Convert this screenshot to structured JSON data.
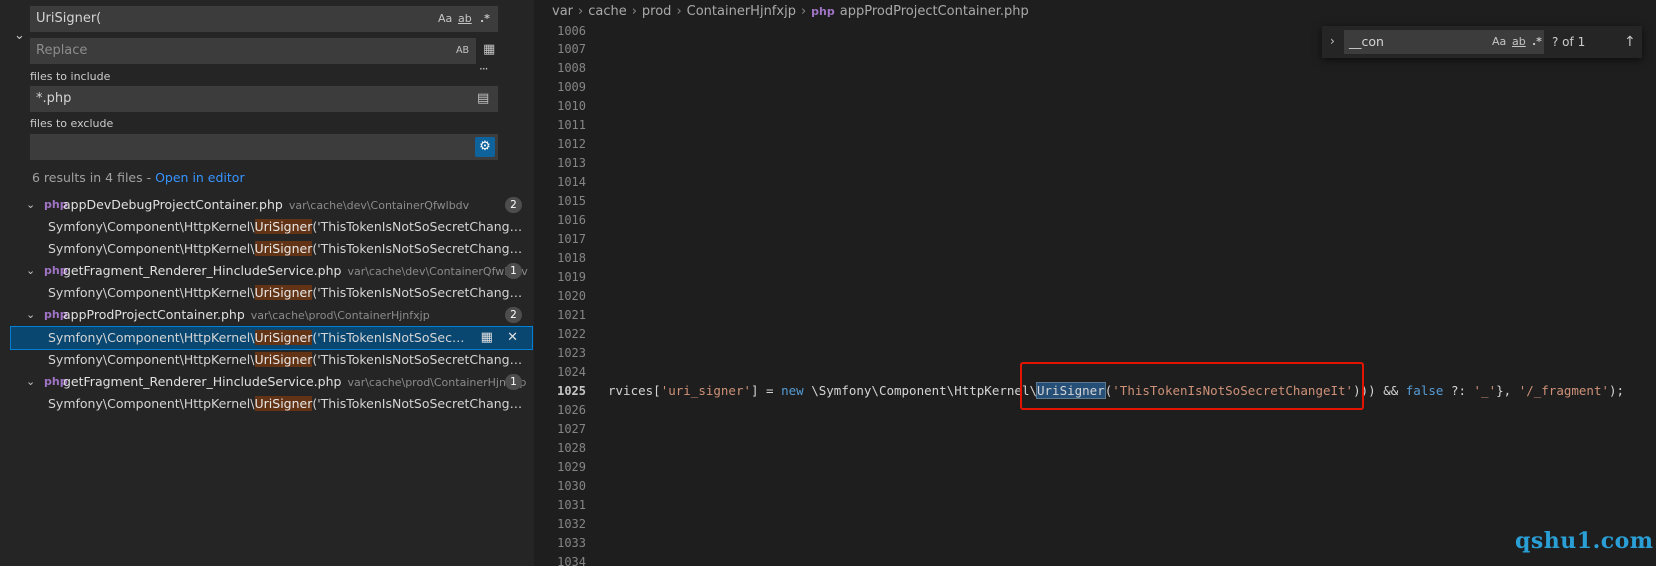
{
  "search": {
    "query": "UriSigner(",
    "replace_placeholder": "Replace",
    "opt_case": "Aa",
    "opt_word": "ab",
    "opt_regex": ".*",
    "opt_preserve_case": "AB",
    "files_to_include_label": "files to include",
    "files_to_include_value": "*.php",
    "files_to_exclude_label": "files to exclude",
    "files_to_exclude_value": "",
    "summary_text": "6 results in 4 files - ",
    "open_in_editor": "Open in editor",
    "more": "···"
  },
  "results": [
    {
      "type": "file",
      "icon": "php-icon",
      "name": "appDevDebugProjectContainer.php",
      "path": "var\\cache\\dev\\ContainerQfwlbdv",
      "count": "2"
    },
    {
      "type": "match",
      "pre": "Symfony\\Component\\HttpKernel\\",
      "hl": "UriSigner",
      "post": "('ThisTokenIsNotSoSecretChangeIt'))) &..."
    },
    {
      "type": "match",
      "pre": "Symfony\\Component\\HttpKernel\\",
      "hl": "UriSigner",
      "post": "('ThisTokenIsNotSoSecretChangeIt');"
    },
    {
      "type": "file",
      "icon": "php-icon",
      "name": "getFragment_Renderer_HincludeService.php",
      "path": "var\\cache\\dev\\ContainerQfwlbdv",
      "count": "1"
    },
    {
      "type": "match",
      "pre": "Symfony\\Component\\HttpKernel\\",
      "hl": "UriSigner",
      "post": "('ThisTokenIsNotSoSecretChangeIt'))) &..."
    },
    {
      "type": "file",
      "icon": "php-icon",
      "name": "appProdProjectContainer.php",
      "path": "var\\cache\\prod\\ContainerHjnfxjp",
      "count": "2"
    },
    {
      "type": "match",
      "selected": true,
      "pre": "Symfony\\Component\\HttpKernel\\",
      "hl": "UriSigner",
      "post": "('ThisTokenIsNotSoSecretCha..."
    },
    {
      "type": "match",
      "pre": "Symfony\\Component\\HttpKernel\\",
      "hl": "UriSigner",
      "post": "('ThisTokenIsNotSoSecretChangeIt');"
    },
    {
      "type": "file",
      "icon": "php-icon",
      "name": "getFragment_Renderer_HincludeService.php",
      "path": "var\\cache\\prod\\ContainerHjnfxjp",
      "count": "1"
    },
    {
      "type": "match",
      "pre": "Symfony\\Component\\HttpKernel\\",
      "hl": "UriSigner",
      "post": "('ThisTokenIsNotSoSecretChangeIt'))) &..."
    }
  ],
  "breadcrumb": [
    "var",
    "cache",
    "prod",
    "ContainerHjnfxjp",
    "appProdProjectContainer.php"
  ],
  "line_numbers": [
    "1006",
    "1007",
    "1008",
    "1009",
    "1010",
    "1011",
    "1012",
    "1013",
    "1014",
    "1015",
    "1016",
    "1017",
    "1018",
    "1019",
    "1020",
    "1021",
    "1022",
    "1023",
    "1024",
    "1025",
    "1026",
    "1027",
    "1028",
    "1029",
    "1030",
    "1031",
    "1032",
    "1033",
    "1034"
  ],
  "active_line": "1025",
  "code_line": {
    "p1": "rvices[",
    "s1": "'uri_signer'",
    "p2": "] = ",
    "k1": "new",
    "p3": " \\Symfony\\Component\\HttpKerne",
    "p4": "l\\",
    "cls": "UriSigner",
    "p5": "(",
    "s2": "'ThisTokenIsNotSoSecretChangeIt'",
    "p6": "))) && ",
    "k2": "false",
    "p7": " ?: ",
    "s3": "'_'",
    "p8": "}, ",
    "s4": "'/_fragment'",
    "p9": ");"
  },
  "find_widget": {
    "value": "__con",
    "opt_case": "Aa",
    "opt_word": "ab",
    "opt_regex": ".*",
    "count": "? of 1"
  },
  "watermark": "qshu1.com"
}
